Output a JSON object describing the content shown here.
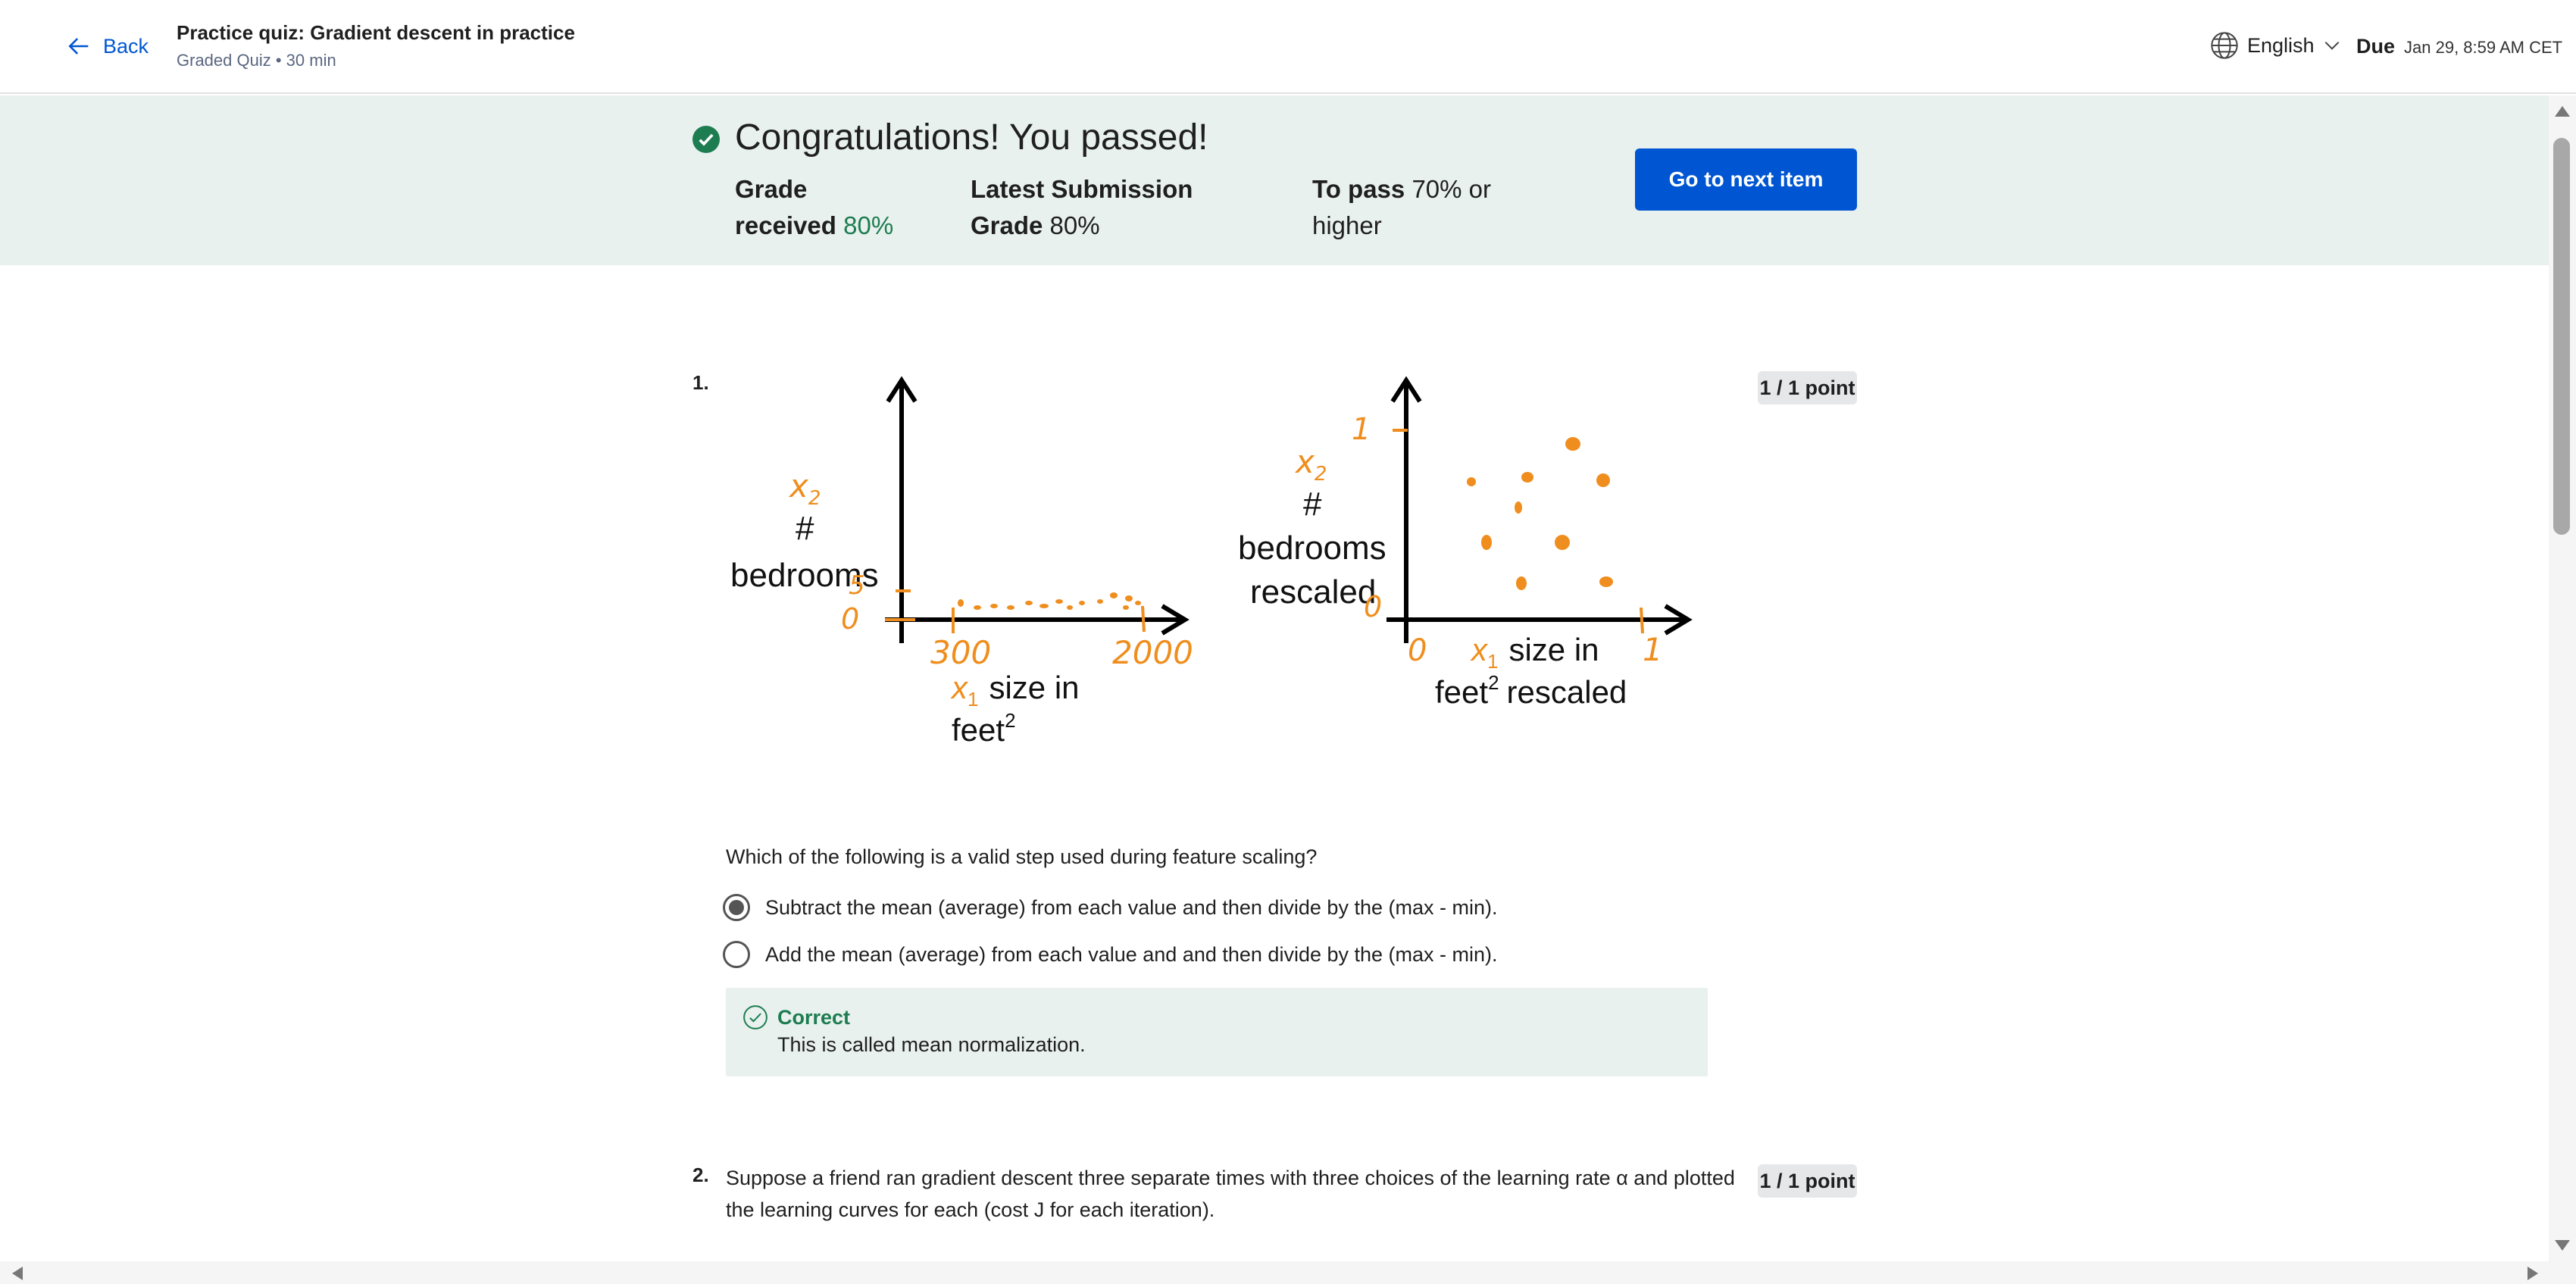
{
  "header": {
    "back_label": "Back",
    "title": "Practice quiz: Gradient descent in practice",
    "subtitle": "Graded Quiz • 30 min",
    "language": "English",
    "due_label": "Due",
    "due_date": "Jan 29, 8:59 AM CET"
  },
  "banner": {
    "title": "Congratulations! You passed!",
    "grade_label_1": "Grade",
    "grade_label_2": "received",
    "grade_value": "80%",
    "latest_label_1": "Latest Submission",
    "latest_label_2": "Grade",
    "latest_value": "80%",
    "pass_label": "To pass",
    "pass_value_1": "70% or",
    "pass_value_2": "higher",
    "next_button": "Go to next item",
    "colors": {
      "banner_bg": "#e8f1ee",
      "success": "#1d7c50",
      "button": "#0056d2"
    }
  },
  "question1": {
    "number": "1.",
    "points": "1 / 1 point",
    "figure": {
      "left": {
        "y_var": "x",
        "y_sub": "2",
        "y_label_1": "#",
        "y_label_2": "bedrooms",
        "y_tick_top": "5",
        "y_tick_zero": "0",
        "x_tick_1": "300",
        "x_tick_2": "2000",
        "x_var": "x",
        "x_sub": "1",
        "x_label_1": "size in",
        "x_label_2": "feet",
        "x_sup": "2"
      },
      "right": {
        "y_var": "x",
        "y_sub": "2",
        "y_label_1": "#",
        "y_label_2": "bedrooms",
        "y_label_3": "rescaled",
        "y_tick_top": "1",
        "y_tick_zero": "0",
        "x_tick_0": "0",
        "x_tick_1": "1",
        "x_var": "x",
        "x_sub": "1",
        "x_label_1": "size in",
        "x_label_2": "feet",
        "x_sup": "2",
        "x_label_3": "rescaled"
      }
    },
    "question": "Which of the following is a valid step used during feature scaling?",
    "options": [
      {
        "label": "Subtract the mean (average) from each value and then divide by the (max - min).",
        "selected": true
      },
      {
        "label": "Add the mean (average) from each value and and then divide by the (max - min).",
        "selected": false
      }
    ],
    "feedback": {
      "title": "Correct",
      "text": "This is called mean normalization."
    }
  },
  "question2": {
    "number": "2.",
    "points": "1 / 1 point",
    "line1": "Suppose a friend ran gradient descent three separate times with three choices of the learning rate α and plotted",
    "line2": "the learning curves for each (cost J for each iteration)."
  }
}
